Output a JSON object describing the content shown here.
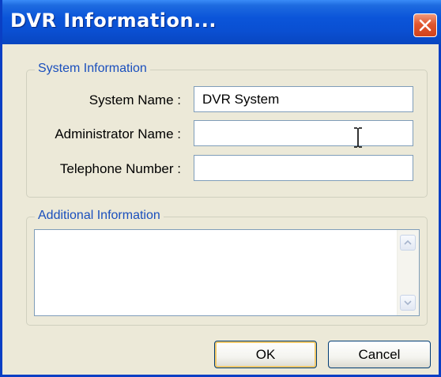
{
  "window": {
    "title": "DVR Information...",
    "close_icon": "close-icon"
  },
  "system_info": {
    "legend": "System Information",
    "system_name_label": "System Name :",
    "system_name_value": "DVR System",
    "admin_name_label": "Administrator Name :",
    "admin_name_value": "",
    "telephone_label": "Telephone Number :",
    "telephone_value": ""
  },
  "additional_info": {
    "legend": "Additional Information",
    "value": ""
  },
  "buttons": {
    "ok_label": "OK",
    "cancel_label": "Cancel"
  },
  "colors": {
    "titlebar": "#0a4fd2",
    "legend_text": "#1a4fbd",
    "close_button": "#e0562f",
    "dialog_background": "#ece9d8"
  }
}
